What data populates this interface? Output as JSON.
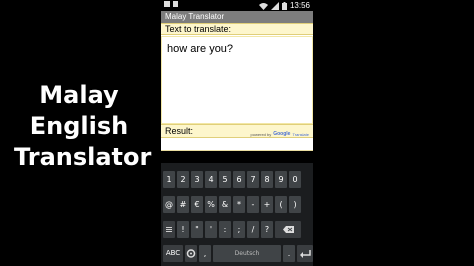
{
  "side_title_lines": [
    "Malay",
    "English",
    "Translator"
  ],
  "status": {
    "time": "13:56"
  },
  "app": {
    "title": "Malay Translator",
    "text_label": "Text to translate:",
    "input_value": "how are you?",
    "result_label": "Result:",
    "powered_by": "powered by",
    "google": "Google",
    "translate": "Translate"
  },
  "keyboard": {
    "row1": [
      "1",
      "2",
      "3",
      "4",
      "5",
      "6",
      "7",
      "8",
      "9",
      "0"
    ],
    "row2": [
      "@",
      "#",
      "€",
      "%",
      "&",
      "*",
      "-",
      "+",
      "(",
      ")"
    ],
    "row3_keys": [
      "!",
      "\"",
      "'",
      ":",
      ";",
      "/",
      "?"
    ],
    "row4": {
      "abc": "ABC",
      "comma": ",",
      "space": "Deutsch",
      "period": "."
    }
  },
  "icons": [
    "wifi-icon",
    "signal-icon",
    "battery-icon",
    "backspace-icon",
    "enter-icon",
    "settings-icon",
    "notification-icon"
  ]
}
